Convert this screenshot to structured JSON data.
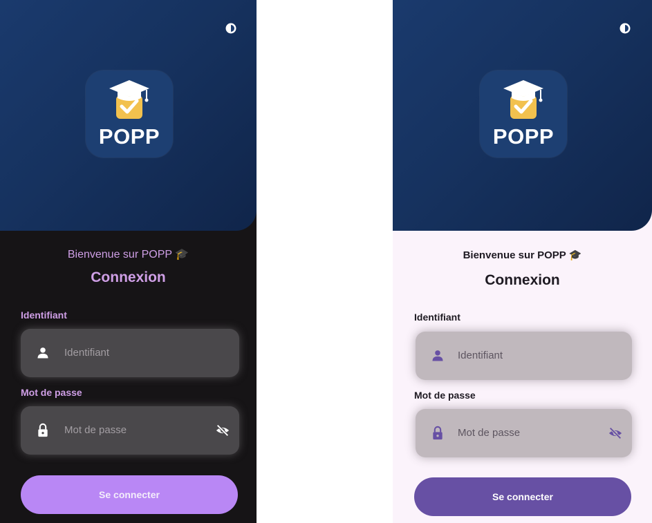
{
  "brand": {
    "name": "POPP"
  },
  "screens": [
    {
      "theme": "dark",
      "welcome": "Bienvenue sur POPP 🎓",
      "title": "Connexion",
      "username": {
        "label": "Identifiant",
        "placeholder": "Identifiant",
        "icon": "person-icon"
      },
      "password": {
        "label": "Mot de passe",
        "placeholder": "Mot de passe",
        "icon": "lock-icon",
        "toggle_icon": "visibility-off-icon"
      },
      "submit": {
        "label": "Se connecter"
      }
    },
    {
      "theme": "light",
      "welcome": "Bienvenue sur POPP 🎓",
      "title": "Connexion",
      "username": {
        "label": "Identifiant",
        "placeholder": "Identifiant",
        "icon": "person-icon"
      },
      "password": {
        "label": "Mot de passe",
        "placeholder": "Mot de passe",
        "icon": "lock-icon",
        "toggle_icon": "visibility-off-icon"
      },
      "submit": {
        "label": "Se connecter"
      }
    }
  ],
  "colors": {
    "hero_gradient": [
      "#1a3a6d",
      "#10254a"
    ],
    "dark_accent": "#cf9fe6",
    "dark_button": "#b987f5",
    "light_button": "#6750a4",
    "light_icon": "#6750a4",
    "logo_checkbox": "#f2c14e"
  }
}
